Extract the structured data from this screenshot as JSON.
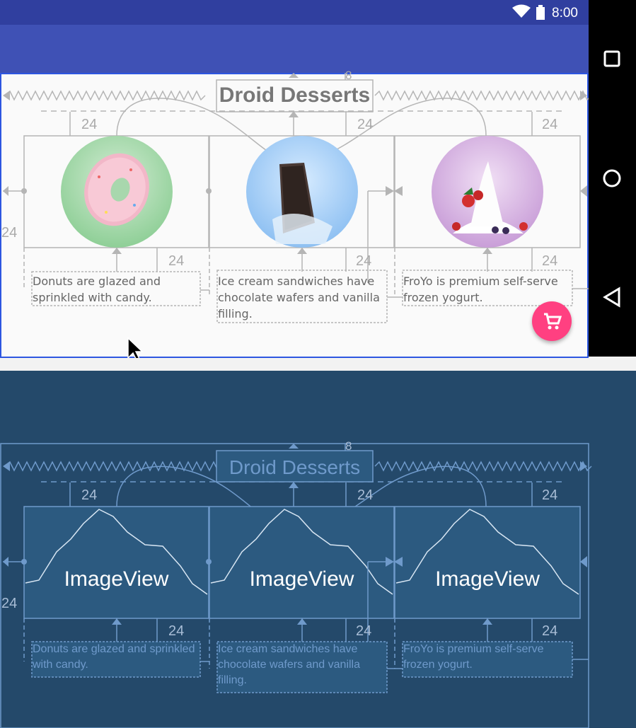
{
  "status_bar": {
    "time": "8:00",
    "icons": [
      "wifi-icon",
      "battery-icon"
    ]
  },
  "nav_bar": {
    "icons": [
      "recents-square-icon",
      "home-circle-icon",
      "back-triangle-icon"
    ]
  },
  "design": {
    "title": "Droid Desserts",
    "descriptions": [
      "Donuts are glazed and sprinkled with candy.",
      "Ice cream sandwiches have chocolate wafers and vanilla filling.",
      "FroYo is premium self-serve frozen yogurt."
    ],
    "margins": {
      "top_title": "8",
      "image_top": "24",
      "text_top": "24",
      "left": "24"
    },
    "fab_icon": "shopping-cart-icon"
  },
  "blueprint": {
    "title": "Droid Desserts",
    "image_label": "ImageView",
    "descriptions": [
      "Donuts are glazed and sprinkled with candy.",
      "Ice cream sandwiches have chocolate wafers and vanilla filling.",
      "FroYo is premium self-serve frozen yogurt."
    ],
    "margins": {
      "top_title": "8",
      "image_top": "24",
      "text_top": "24",
      "left": "24"
    }
  },
  "colors": {
    "primary": "#3f51b5",
    "primary_dark": "#303f9f",
    "accent": "#ff4081",
    "blueprint_bg": "#24496a",
    "selection": "#2d56e0"
  }
}
